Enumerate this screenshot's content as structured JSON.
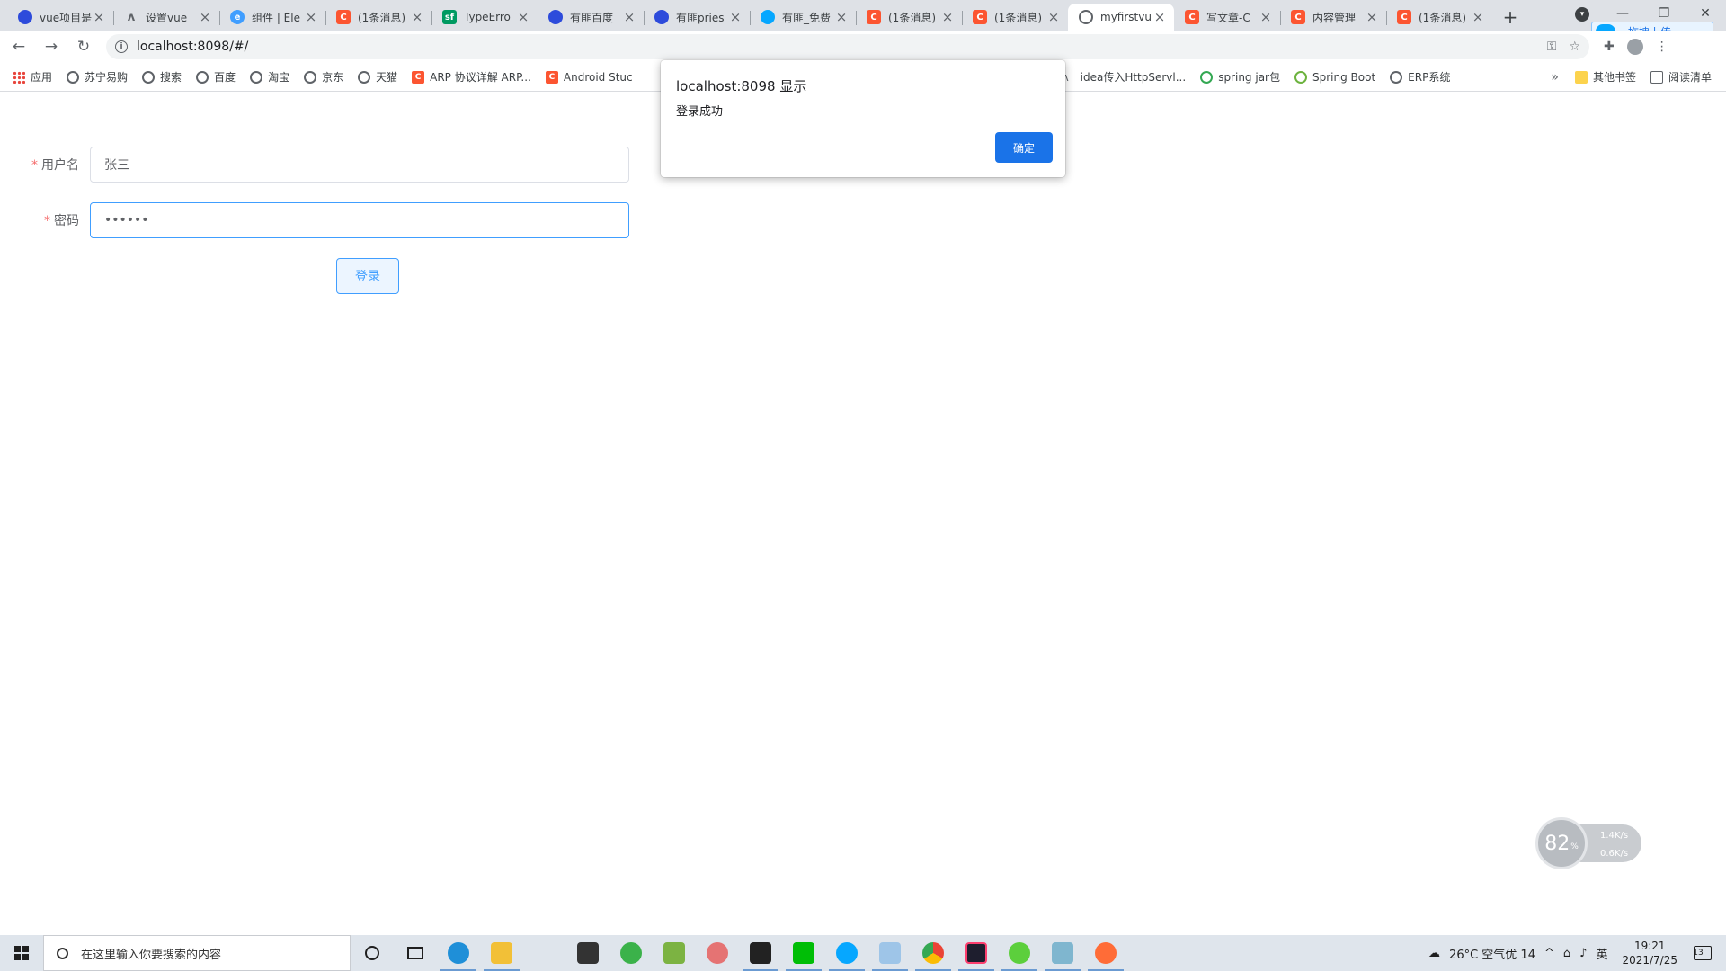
{
  "tabs": [
    {
      "title": "vue项目是",
      "favicon": "paw-icon",
      "active": false
    },
    {
      "title": "设置vue",
      "favicon": "v-icon",
      "active": false
    },
    {
      "title": "组件 | Ele",
      "favicon": "element-icon",
      "active": false
    },
    {
      "title": "(1条消息)",
      "favicon": "csdn-icon",
      "active": false
    },
    {
      "title": "TypeErro",
      "favicon": "sf-icon",
      "active": false
    },
    {
      "title": "有匪百度",
      "favicon": "paw-icon",
      "active": false
    },
    {
      "title": "有匪pries",
      "favicon": "paw-icon",
      "active": false
    },
    {
      "title": "有匪_免费",
      "favicon": "cloud-icon",
      "active": false
    },
    {
      "title": "(1条消息)",
      "favicon": "csdn-icon",
      "active": false
    },
    {
      "title": "(1条消息)",
      "favicon": "csdn-icon",
      "active": false
    },
    {
      "title": "myfirstvu",
      "favicon": "globe-icon",
      "active": true
    },
    {
      "title": "写文章-C",
      "favicon": "csdn-icon",
      "active": false
    },
    {
      "title": "内容管理",
      "favicon": "csdn-icon",
      "active": false
    },
    {
      "title": "(1条消息)",
      "favicon": "csdn-icon",
      "active": false
    }
  ],
  "upload_tip": "拖拽上传",
  "address": {
    "url": "localhost:8098/#/"
  },
  "bookmarks": {
    "left": [
      {
        "label": "应用",
        "icon": "apps-icon"
      },
      {
        "label": "苏宁易购",
        "icon": "globe-icon"
      },
      {
        "label": "搜索",
        "icon": "globe-icon"
      },
      {
        "label": "百度",
        "icon": "globe-icon"
      },
      {
        "label": "淘宝",
        "icon": "globe-icon"
      },
      {
        "label": "京东",
        "icon": "globe-icon"
      },
      {
        "label": "天猫",
        "icon": "globe-icon"
      },
      {
        "label": "ARP 协议详解 ARP...",
        "icon": "csdn-icon"
      },
      {
        "label": "Android Stuc",
        "icon": "csdn-icon"
      }
    ],
    "after_dialog": [
      {
        "label": "idea传入HttpServl...",
        "icon": "v-icon"
      },
      {
        "label": "spring jar包",
        "icon": "jar-icon"
      },
      {
        "label": "Spring Boot",
        "icon": "spring-icon"
      },
      {
        "label": "ERP系统",
        "icon": "globe-icon"
      }
    ],
    "more": "»",
    "other": "其他书签",
    "reading_list": "阅读清单"
  },
  "form": {
    "username_label": "用户名",
    "username_value": "张三",
    "password_label": "密码",
    "password_value": "••••••",
    "required_mark": "*",
    "login_label": "登录"
  },
  "dialog": {
    "title": "localhost:8098 显示",
    "message": "登录成功",
    "ok_label": "确定"
  },
  "speed_widget": {
    "percent": "82",
    "percent_unit": "%",
    "up": "1.4K/s",
    "down": "0.6K/s"
  },
  "taskbar": {
    "search_placeholder": "在这里输入你要搜索的内容",
    "weather": "26°C  空气优 14",
    "ime": "英",
    "time": "19:21",
    "date": "2021/7/25",
    "notification_count": "13"
  },
  "colors": {
    "primary": "#409eff",
    "required": "#f56c6c",
    "dialog_button": "#1a73e8"
  }
}
